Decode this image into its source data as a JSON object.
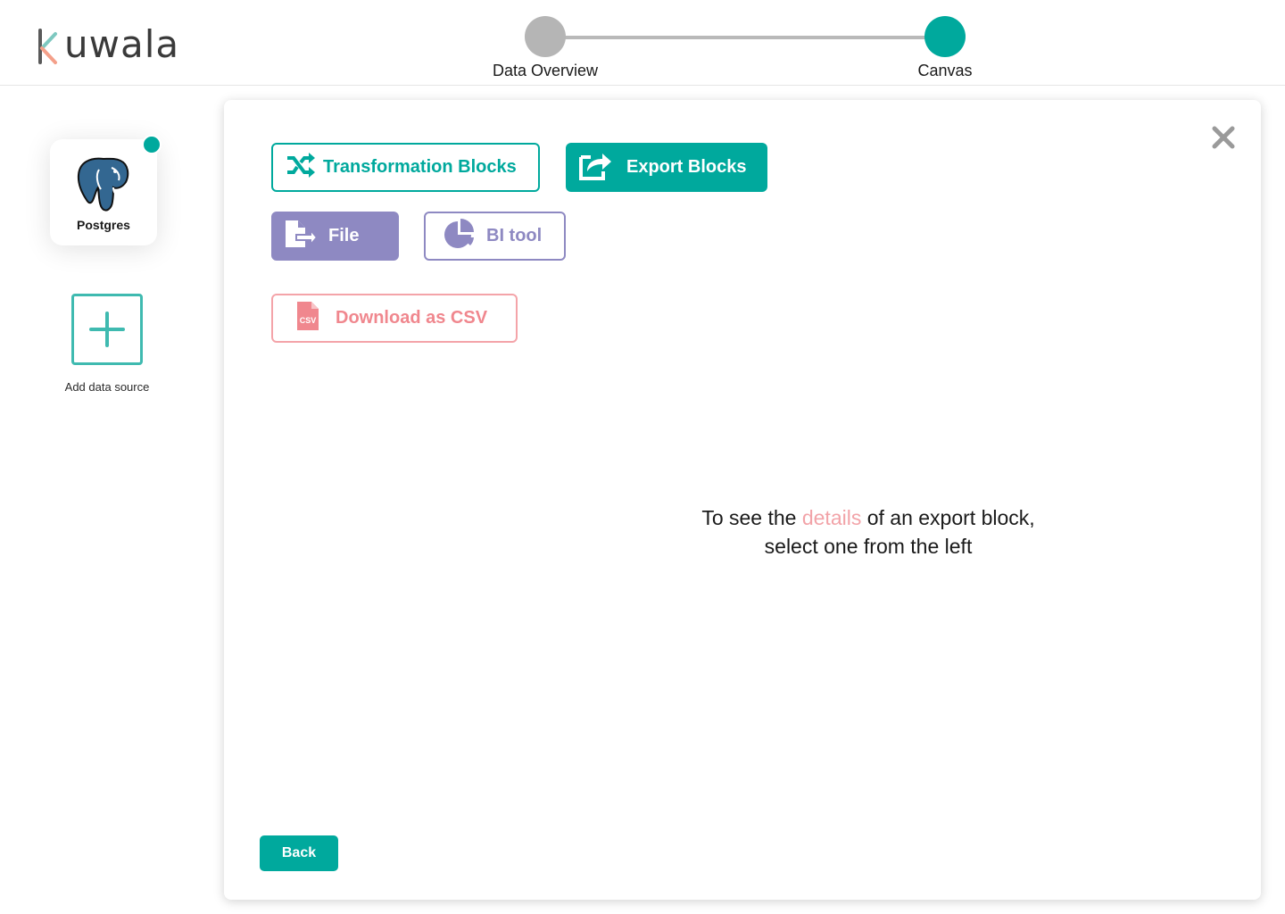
{
  "brand": {
    "name": "uwala"
  },
  "stepper": {
    "steps": [
      {
        "label": "Data Overview",
        "state": "inactive",
        "color": "#b5b5b5"
      },
      {
        "label": "Canvas",
        "state": "active",
        "color": "#00a99d"
      }
    ]
  },
  "sidebar": {
    "sources": [
      {
        "label": "Postgres",
        "icon": "postgres-elephant-icon",
        "status_color": "#00a99d"
      }
    ],
    "add_source_label": "Add data source"
  },
  "modal": {
    "category_tabs": [
      {
        "label": "Transformation Blocks",
        "icon": "shuffle-icon",
        "selected": false
      },
      {
        "label": "Export Blocks",
        "icon": "share-export-icon",
        "selected": true
      }
    ],
    "export_types": [
      {
        "label": "File",
        "icon": "file-export-icon",
        "selected": true
      },
      {
        "label": "BI tool",
        "icon": "pie-chart-icon",
        "selected": false
      }
    ],
    "blocks": [
      {
        "label": "Download as CSV",
        "icon": "csv-file-icon"
      }
    ],
    "hint": {
      "before": "To see the ",
      "highlight": "details",
      "after": " of an export block,",
      "line2": "select one from the left"
    },
    "back_label": "Back"
  },
  "colors": {
    "primary": "#00a99d",
    "secondary": "#8e89c2",
    "accent": "#f0878e"
  }
}
